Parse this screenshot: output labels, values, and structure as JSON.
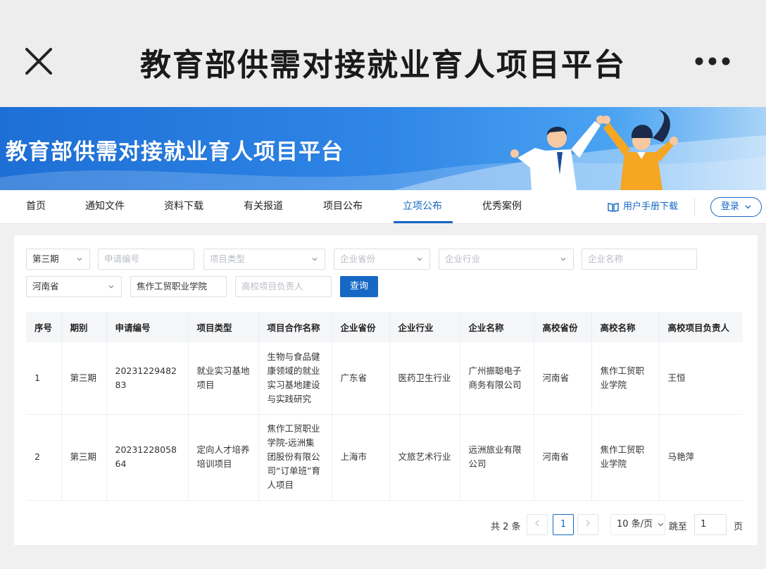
{
  "appbar": {
    "title": "教育部供需对接就业育人项目平台"
  },
  "banner": {
    "title": "教育部供需对接就业育人项目平台"
  },
  "nav": {
    "items": [
      "首页",
      "通知文件",
      "资料下载",
      "有关报道",
      "项目公布",
      "立项公布",
      "优秀案例"
    ],
    "active": "立项公布",
    "manual": "用户手册下载",
    "login": "登录"
  },
  "filters": {
    "period": "第三期",
    "app_no_ph": "申请编号",
    "type_ph": "项目类型",
    "ent_province_ph": "企业省份",
    "industry_ph": "企业行业",
    "ent_name_ph": "企业名称",
    "school_province": "河南省",
    "school_name": "焦作工贸职业学院",
    "leader_ph": "高校项目负责人",
    "query": "查询"
  },
  "table": {
    "headers": [
      "序号",
      "期别",
      "申请编号",
      "项目类型",
      "项目合作名称",
      "企业省份",
      "企业行业",
      "企业名称",
      "高校省份",
      "高校名称",
      "高校项目负责人"
    ],
    "rows": [
      [
        "1",
        "第三期",
        "2023122948283",
        "就业实习基地项目",
        "生物与食品健康领域的就业实习基地建设与实践研究",
        "广东省",
        "医药卫生行业",
        "广州振聪电子商务有限公司",
        "河南省",
        "焦作工贸职业学院",
        "王恒"
      ],
      [
        "2",
        "第三期",
        "2023122805864",
        "定向人才培养培训项目",
        "焦作工贸职业学院-远洲集团股份有限公司“订单班”育人项目",
        "上海市",
        "文旅艺术行业",
        "远洲旅业有限公司",
        "河南省",
        "焦作工贸职业学院",
        "马艳萍"
      ]
    ]
  },
  "pager": {
    "total": "共 2 条",
    "current": "1",
    "size": "10 条/页",
    "jump_label": "跳至",
    "jump_value": "1",
    "page_label": "页"
  },
  "colors": {
    "primary": "#1668c4",
    "banner": "#2f86e6"
  }
}
